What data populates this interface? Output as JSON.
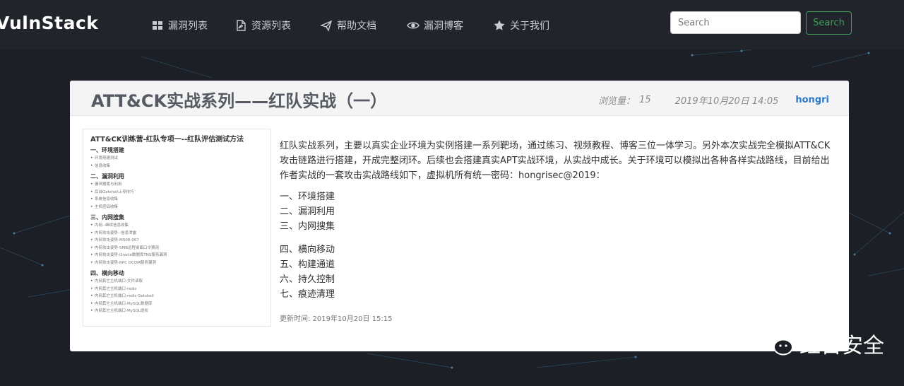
{
  "navbar": {
    "brand": "VulnStack",
    "items": [
      {
        "label": "漏洞列表",
        "icon": "grid-icon"
      },
      {
        "label": "资源列表",
        "icon": "file-pdf-icon"
      },
      {
        "label": "帮助文档",
        "icon": "paper-plane-icon"
      },
      {
        "label": "漏洞博客",
        "icon": "eye-icon"
      },
      {
        "label": "关于我们",
        "icon": "star-icon"
      }
    ],
    "search_placeholder": "Search",
    "search_button": "Search"
  },
  "post": {
    "title": "ATT&CK实战系列——红队实战（一）",
    "views_label": "浏览量：",
    "views_count": "15",
    "date": "2019年10月20日 14:05",
    "author": "hongri",
    "intro": "红队实战系列，主要以真实企业环境为实例搭建一系列靶场，通过练习、视频教程、博客三位一体学习。另外本次实战完全模拟ATT&CK攻击链路进行搭建，开成完整闭环。后续也会搭建真实APT实战环境，从实战中成长。关于环境可以模拟出各种各样实战路线，目前给出作者实战的一套攻击实战路线如下，虚拟机所有统一密码：hongrisec@2019：",
    "list_group_1": [
      "一、环境搭建",
      "二、漏洞利用",
      "三、内网搜集"
    ],
    "list_group_2": [
      "四、横向移动",
      "五、构建通道",
      "六、持久控制",
      "七、痕迹清理"
    ],
    "updated": "更新时间: 2019年10月20日 15:15"
  },
  "toc": {
    "title": "ATT&CK训练营-红队专项一--红队评估测试方法",
    "sections": [
      {
        "heading": "一、环境搭建",
        "items": [
          "环境搭建测试",
          "信息收集"
        ]
      },
      {
        "heading": "二、漏洞利用",
        "items": [
          "漏洞搜索与利用",
          "后台Getshell上传技巧",
          "系统信息收集",
          "主机密码收集"
        ]
      },
      {
        "heading": "三、内网搜集",
        "items": [
          "内网--继续信息收集",
          "内网攻击姿势--信息泄露",
          "内网攻击姿势-MS08-067",
          "内网攻击姿势-SMB远程桌面口令猜测",
          "内网攻击姿势-Oracle数据库TNS服务漏洞",
          "内网攻击姿势-RPC DCOM服务漏洞"
        ]
      },
      {
        "heading": "四、横向移动",
        "items": [
          "内网其它主机端口-文件读取",
          "内网其它主机端口-redis",
          "内网其它主机端口-redis Getshell",
          "内网其它主机端口-MySQL数据库",
          "内网其它主机端口-MySQL提权"
        ]
      }
    ]
  },
  "watermark": {
    "text": "红日安全",
    "icon": "wechat-icon"
  },
  "colors": {
    "navbar_bg": "#21242b",
    "page_bg": "#1c1f26",
    "accent_green": "#3fa15a",
    "author_blue": "#2b7ac9"
  }
}
